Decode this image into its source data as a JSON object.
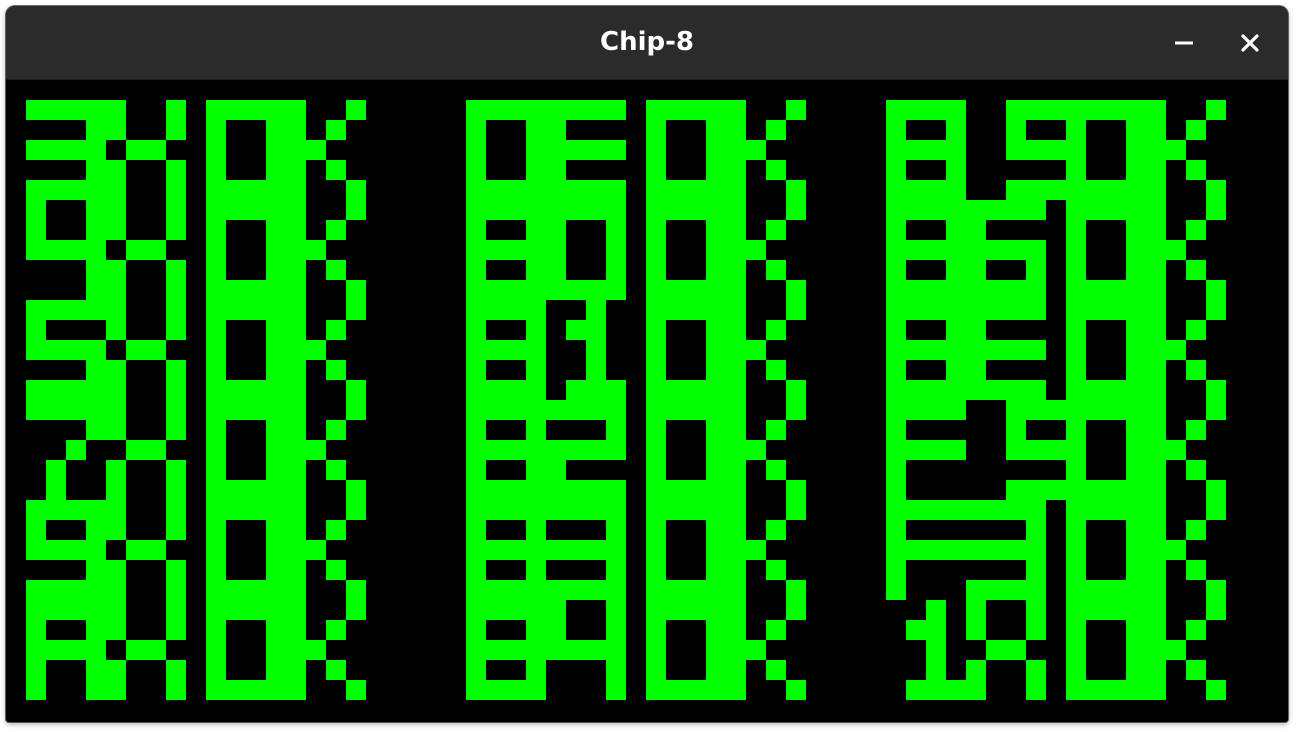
{
  "window": {
    "title": "Chip-8",
    "buttons": [
      {
        "name": "minimize",
        "icon": "minimize-icon"
      },
      {
        "name": "close",
        "icon": "close-icon"
      }
    ]
  },
  "display": {
    "pixel_color": "#00ff00",
    "background_color": "#000000",
    "resolution": [
      64,
      32
    ],
    "rows": [
      [
        {
          "label": "3X",
          "status": "OK"
        },
        {
          "label": "0E",
          "status": "OK"
        },
        {
          "label": "8 5",
          "status": "OK"
        }
      ],
      [
        {
          "label": "4X",
          "status": "OK"
        },
        {
          "label": "80",
          "status": "OK"
        },
        {
          "label": "86",
          "status": "OK"
        }
      ],
      [
        {
          "label": "5X",
          "status": "OK"
        },
        {
          "label": "81",
          "status": "OK"
        },
        {
          "label": "8E",
          "status": "OK"
        }
      ],
      [
        {
          "label": "7X",
          "status": "OK"
        },
        {
          "label": "82",
          "status": "OK"
        },
        {
          "label": "F 5",
          "status": "OK"
        }
      ],
      [
        {
          "label": "9X",
          "status": "OK"
        },
        {
          "label": "83",
          "status": "OK"
        },
        {
          "label": "F3",
          "status": "OK"
        }
      ],
      [
        {
          "label": "AX",
          "status": "OK"
        },
        {
          "label": "84",
          "status": "OK"
        },
        {
          "label": "1X",
          "status": "OK"
        }
      ]
    ]
  }
}
